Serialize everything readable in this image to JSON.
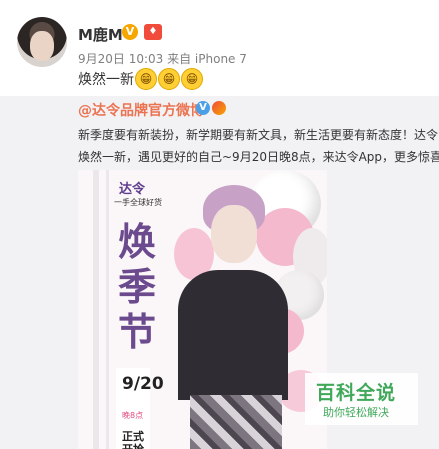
{
  "post": {
    "author": "M鹿M",
    "meta": "9月20日 10:03 来自 iPhone 7",
    "text": "焕然一新",
    "emoji_count": 3
  },
  "repost": {
    "author": "@达令品牌官方微博",
    "text_line1": "新季度要有新装扮，新学期要有新文具，新生活更要有新态度！达令",
    "text_line2": "焕然一新，遇见更好的自己~9月20日晚8点，来达令App，更多惊喜在"
  },
  "poster": {
    "brand": "达令",
    "slogan": "一手全球好货",
    "title_chars": [
      "焕",
      "季",
      "节"
    ],
    "date": "9/20",
    "date_note": "晚8点",
    "open_1": "正式",
    "open_2": "开抢"
  },
  "watermark": {
    "title": "百科全说",
    "subtitle": "助你轻松解决"
  }
}
